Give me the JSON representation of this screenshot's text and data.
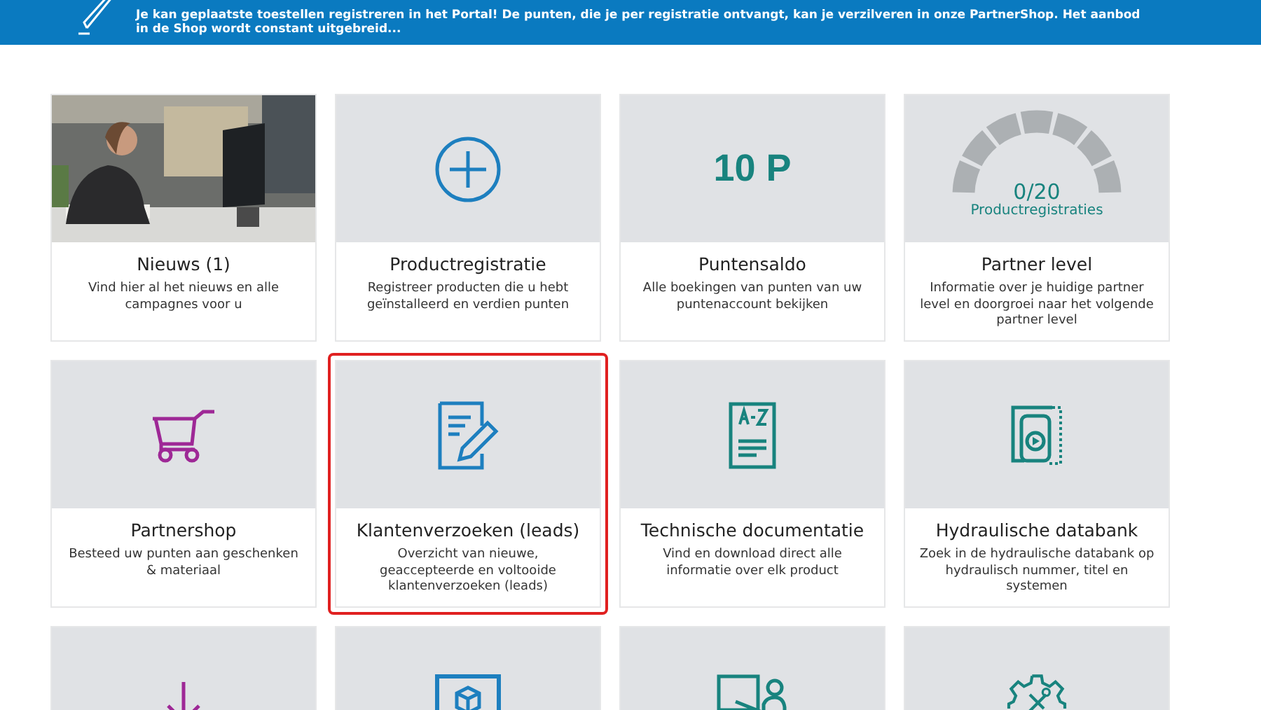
{
  "banner": {
    "text": "Je kan geplaatste toestellen registreren in het Portal! De punten, die je per registratie ontvangt, kan je verzilveren in onze PartnerShop. Het aanbod in de Shop wordt constant uitgebreid..."
  },
  "tiles": [
    {
      "title": "Nieuws (1)",
      "description": "Vind hier al het nieuws en alle campagnes voor u",
      "highlighted": false
    },
    {
      "kind": "icon",
      "title": "Productregistratie",
      "description": "Registreer producten die u hebt geïnstalleerd en verdien punten",
      "highlighted": false
    },
    {
      "kind": "points",
      "value": "10 P",
      "title": "Puntensaldo",
      "description": "Alle boekingen van punten van uw puntenaccount bekijken",
      "highlighted": false
    },
    {
      "kind": "gauge",
      "count": "0/20",
      "caption": "Productregistraties",
      "title": "Partner level",
      "description": "Informatie over je huidige partner level en doorgroei naar het volgende partner level",
      "highlighted": false
    },
    {
      "kind": "icon",
      "title": "Partnershop",
      "description": "Besteed uw punten aan geschenken & materiaal",
      "highlighted": false
    },
    {
      "kind": "icon",
      "title": "Klantenverzoeken (leads)",
      "description": "Overzicht van nieuwe, geaccepteerde en voltooide klantenverzoeken (leads)",
      "highlighted": true
    },
    {
      "kind": "icon",
      "title": "Technische documentatie",
      "description": "Vind en download direct alle informatie over elk product",
      "highlighted": false
    },
    {
      "kind": "icon",
      "title": "Hydraulische databank",
      "description": "Zoek in de hydraulische databank op hydraulisch nummer, titel en systemen",
      "highlighted": false
    },
    {
      "kind": "icon",
      "highlighted": false
    },
    {
      "kind": "icon",
      "highlighted": false
    },
    {
      "kind": "icon",
      "highlighted": false
    },
    {
      "kind": "icon",
      "highlighted": false
    }
  ]
}
